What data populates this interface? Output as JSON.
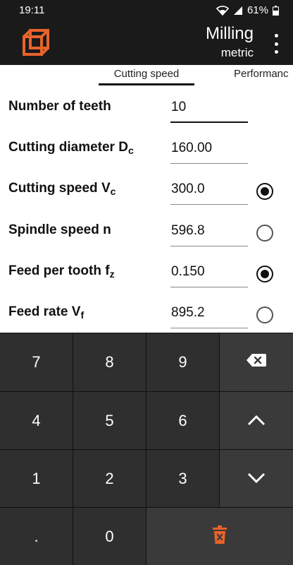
{
  "status_bar": {
    "time": "19:11",
    "battery": "61%"
  },
  "app_bar": {
    "title": "Milling",
    "subtitle": "metric"
  },
  "tabs": [
    {
      "label": "Cutting speed"
    },
    {
      "label": "Performanc"
    }
  ],
  "fields": [
    {
      "label": "Number of teeth",
      "sub": "",
      "value": "10",
      "radio": null
    },
    {
      "label": "Cutting diameter D",
      "sub": "c",
      "value": "160.00",
      "radio": null
    },
    {
      "label": "Cutting speed V",
      "sub": "c",
      "value": "300.0",
      "radio": true
    },
    {
      "label": "Spindle speed n",
      "sub": "",
      "value": "596.8",
      "radio": false
    },
    {
      "label": "Feed per tooth f",
      "sub": "z",
      "value": "0.150",
      "radio": true
    },
    {
      "label": "Feed rate V",
      "sub": "f",
      "value": "895.2",
      "radio": false
    }
  ],
  "keypad": {
    "k7": "7",
    "k8": "8",
    "k9": "9",
    "k4": "4",
    "k5": "5",
    "k6": "6",
    "k1": "1",
    "k2": "2",
    "k3": "3",
    "kdot": ".",
    "k0": "0"
  },
  "colors": {
    "accent": "#e8632a",
    "bar": "#1a1a1a",
    "key": "#2f2f2f"
  }
}
